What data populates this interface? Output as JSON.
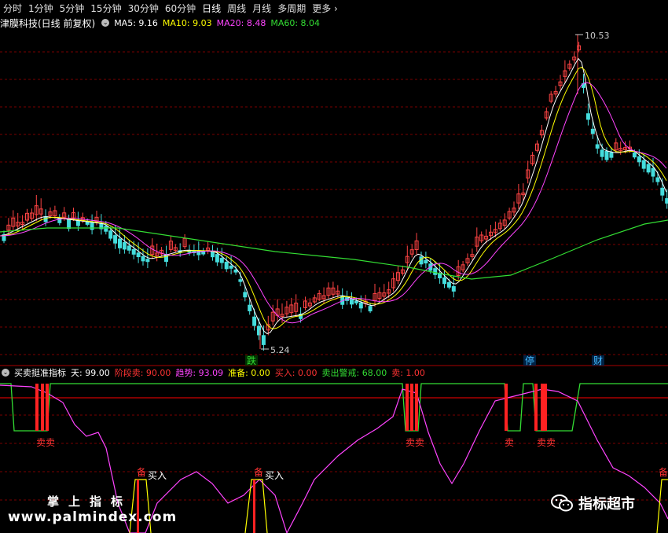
{
  "periods": [
    "分时",
    "1分钟",
    "5分钟",
    "15分钟",
    "30分钟",
    "60分钟",
    "日线",
    "周线",
    "月线",
    "多周期",
    "更多"
  ],
  "active_period": "日线",
  "stock": {
    "title": "津膜科技(日线 前复权)"
  },
  "ma_legend": [
    {
      "text": "MA5: 9.16",
      "color": "#ffffff"
    },
    {
      "text": "MA10: 9.03",
      "color": "#ffff00"
    },
    {
      "text": "MA20: 8.48",
      "color": "#ff44ff"
    },
    {
      "text": "MA60: 8.04",
      "color": "#33dd33"
    }
  ],
  "price_labels": {
    "high": "10.53",
    "low": "5.24"
  },
  "markers": [
    {
      "text": "跌",
      "color": "#33dd33"
    },
    {
      "text": "停",
      "color": "#44bbff"
    },
    {
      "text": "财",
      "color": "#44bbff"
    }
  ],
  "indicator": {
    "title": "买卖挺准指标",
    "values": [
      {
        "text": "天: 99.00",
        "color": "#ffffff"
      },
      {
        "text": "阶段卖: 90.00",
        "color": "#ff3333"
      },
      {
        "text": "趋势: 93.09",
        "color": "#ff44ff"
      },
      {
        "text": "准备: 0.00",
        "color": "#ffff00"
      },
      {
        "text": "买入: 0.00",
        "color": "#ff3333"
      },
      {
        "text": "卖出警戒: 68.00",
        "color": "#33dd33"
      },
      {
        "text": "卖: 1.00",
        "color": "#ff3333"
      }
    ],
    "signals": [
      {
        "text": "卖卖",
        "color": "#ff3333"
      },
      {
        "text": "卖卖",
        "color": "#ff3333"
      },
      {
        "text": "卖",
        "color": "#ff3333"
      },
      {
        "text": "卖卖",
        "color": "#ff3333"
      },
      {
        "text": "备",
        "color": "#ff3333"
      },
      {
        "text": "买入",
        "color": "#ffffff"
      },
      {
        "text": "备",
        "color": "#ff3333"
      },
      {
        "text": "买入",
        "color": "#ffffff"
      },
      {
        "text": "备",
        "color": "#ff3333"
      }
    ]
  },
  "watermark": {
    "cn": "掌上指标",
    "url": "www.palmindex.com",
    "brand": "指标超市"
  }
}
